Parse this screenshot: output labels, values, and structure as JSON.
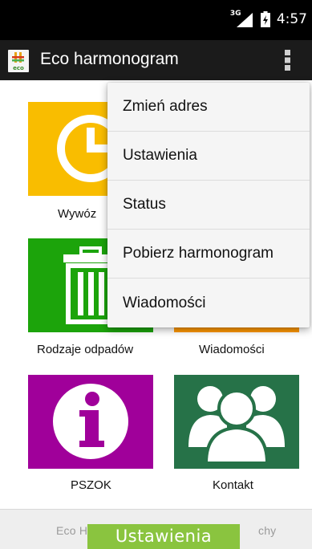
{
  "status_bar": {
    "network_label": "3G",
    "time": "4:57"
  },
  "action_bar": {
    "title": "Eco harmonogram",
    "logo_icon": "eco-logo-icon",
    "overflow_icon": "more-vert-icon"
  },
  "tiles": [
    {
      "label": "Wywóz",
      "icon": "clock-icon",
      "color": "#f9bd00"
    },
    {
      "label": "Rodzaje odpadów",
      "icon": "trash-icon",
      "color": "#1ca40b"
    },
    {
      "label": "Wiadomości",
      "icon": "envelope-icon",
      "color": "#ff9800"
    },
    {
      "label": "PSZOK",
      "icon": "info-icon",
      "color": "#a0009a"
    },
    {
      "label": "Kontakt",
      "icon": "people-icon",
      "color": "#267248"
    }
  ],
  "menu": {
    "items": [
      {
        "label": "Zmień adres"
      },
      {
        "label": "Ustawienia"
      },
      {
        "label": "Status"
      },
      {
        "label": "Pobierz harmonogram"
      },
      {
        "label": "Wiadomości"
      }
    ]
  },
  "footer": {
    "left_text": "Eco H",
    "right_text": "chy"
  },
  "toast": {
    "text": "Ustawienia",
    "color": "#8ac43f"
  }
}
